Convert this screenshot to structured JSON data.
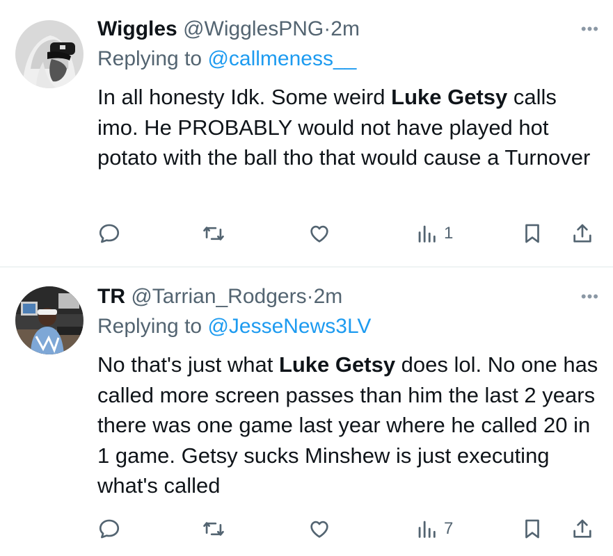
{
  "tweets": [
    {
      "display_name": "Wiggles",
      "handle": "@WigglesPNG",
      "time": "2m",
      "replying_prefix": "Replying to ",
      "replying_to": "@callmeness__",
      "text_part1": "In all honesty Idk. Some weird ",
      "text_bold": "Luke Getsy",
      "text_part2": " calls imo. He PROBABLY would not have played hot potato with the ball tho that would cause a Turnover",
      "views": "1",
      "icons": [
        "reply-icon",
        "retweet-icon",
        "like-icon",
        "views-icon",
        "bookmark-icon",
        "share-icon"
      ]
    },
    {
      "display_name": "TR",
      "handle": "@Tarrian_Rodgers",
      "time": "2m",
      "replying_prefix": "Replying to ",
      "replying_to": "@JesseNews3LV",
      "text_part1": "No that's just what ",
      "text_bold": "Luke Getsy",
      "text_part2": " does lol. No one has called more screen passes than him the last 2 years there was one game last year where he called 20 in 1 game. Getsy sucks Minshew is just executing what's called",
      "views": "7",
      "icons": [
        "reply-icon",
        "retweet-icon",
        "like-icon",
        "views-icon",
        "bookmark-icon",
        "share-icon"
      ]
    }
  ],
  "separator": "·",
  "more_glyph": "•••",
  "colors": {
    "text": "#0f1419",
    "muted": "#536471",
    "link": "#1d9bf0",
    "divider": "#eff3f4"
  }
}
